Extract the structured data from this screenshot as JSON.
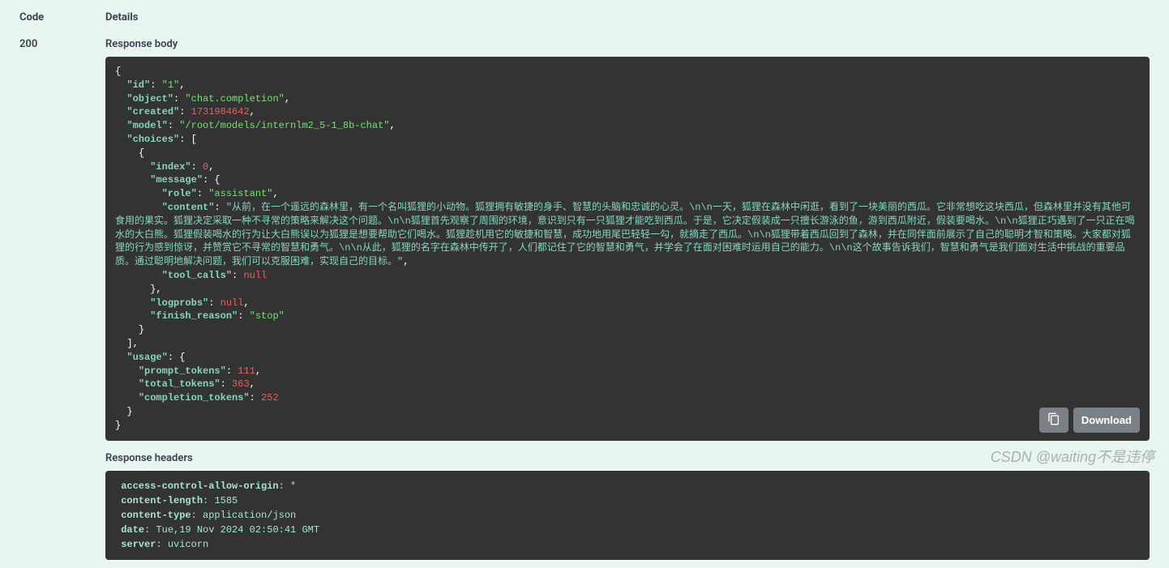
{
  "labels": {
    "code_header": "Code",
    "details_header": "Details",
    "response_body": "Response body",
    "response_headers": "Response headers",
    "download": "Download"
  },
  "code": "200",
  "json": {
    "id_key": "\"id\"",
    "id_val": "\"1\"",
    "object_key": "\"object\"",
    "object_val": "\"chat.completion\"",
    "created_key": "\"created\"",
    "created_val": "1731984642",
    "model_key": "\"model\"",
    "model_val": "\"/root/models/internlm2_5-1_8b-chat\"",
    "choices_key": "\"choices\"",
    "index_key": "\"index\"",
    "index_val": "0",
    "message_key": "\"message\"",
    "role_key": "\"role\"",
    "role_val": "\"assistant\"",
    "content_key": "\"content\"",
    "content_val": "\"从前，在一个遥远的森林里，有一个名叫狐狸的小动物。狐狸拥有敏捷的身手、智慧的头脑和忠诚的心灵。\\n\\n一天，狐狸在森林中闲逛，看到了一块美丽的西瓜。它非常想吃这块西瓜，但森林里并没有其他可食用的果实。狐狸决定采取一种不寻常的策略来解决这个问题。\\n\\n狐狸首先观察了周围的环境，意识到只有一只狐狸才能吃到西瓜。于是，它决定假装成一只擅长游泳的鱼，游到西瓜附近，假装要喝水。\\n\\n狐狸正巧遇到了一只正在喝水的大白熊。狐狸假装喝水的行为让大白熊误以为狐狸是想要帮助它们喝水。狐狸趁机用它的敏捷和智慧，成功地用尾巴轻轻一勾，就摘走了西瓜。\\n\\n狐狸带着西瓜回到了森林，并在同伴面前展示了自己的聪明才智和策略。大家都对狐狸的行为感到惊讶，并赞赏它不寻常的智慧和勇气。\\n\\n从此，狐狸的名字在森林中传开了，人们都记住了它的智慧和勇气，并学会了在面对困难时运用自己的能力。\\n\\n这个故事告诉我们，智慧和勇气是我们面对生活中挑战的重要品质。通过聪明地解决问题，我们可以克服困难，实现自己的目标。\"",
    "tool_calls_key": "\"tool_calls\"",
    "logprobs_key": "\"logprobs\"",
    "null_val": "null",
    "finish_reason_key": "\"finish_reason\"",
    "finish_reason_val": "\"stop\"",
    "usage_key": "\"usage\"",
    "prompt_tokens_key": "\"prompt_tokens\"",
    "prompt_tokens_val": "111",
    "total_tokens_key": "\"total_tokens\"",
    "total_tokens_val": "363",
    "completion_tokens_key": "\"completion_tokens\"",
    "completion_tokens_val": "252"
  },
  "headers": [
    {
      "k": " access-control-allow-origin",
      "v": "* "
    },
    {
      "k": " content-length",
      "v": "1585 "
    },
    {
      "k": " content-type",
      "v": "application/json "
    },
    {
      "k": " date",
      "v": "Tue,19 Nov 2024 02:50:41 GMT "
    },
    {
      "k": " server",
      "v": "uvicorn "
    }
  ],
  "watermark": "CSDN @waiting不是违停"
}
